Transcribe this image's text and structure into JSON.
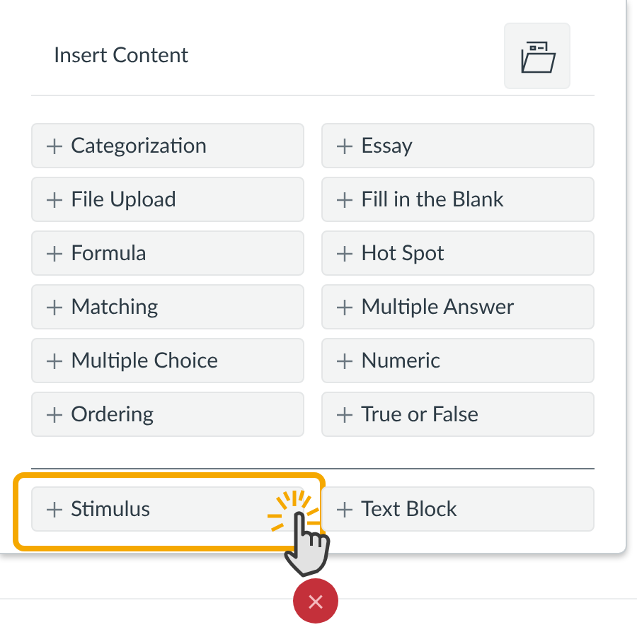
{
  "title": "Insert Content",
  "question_types": [
    {
      "label": "Categorization",
      "highlighted": false
    },
    {
      "label": "Essay",
      "highlighted": false
    },
    {
      "label": "File Upload",
      "highlighted": false
    },
    {
      "label": "Fill in the Blank",
      "highlighted": false
    },
    {
      "label": "Formula",
      "highlighted": false
    },
    {
      "label": "Hot Spot",
      "highlighted": false
    },
    {
      "label": "Matching",
      "highlighted": false
    },
    {
      "label": "Multiple Answer",
      "highlighted": false
    },
    {
      "label": "Multiple Choice",
      "highlighted": false
    },
    {
      "label": "Numeric",
      "highlighted": false
    },
    {
      "label": "Ordering",
      "highlighted": false
    },
    {
      "label": "True or False",
      "highlighted": false
    }
  ],
  "other_types": [
    {
      "label": "Stimulus",
      "highlighted": true
    },
    {
      "label": "Text Block",
      "highlighted": false
    }
  ],
  "close_button": "×"
}
